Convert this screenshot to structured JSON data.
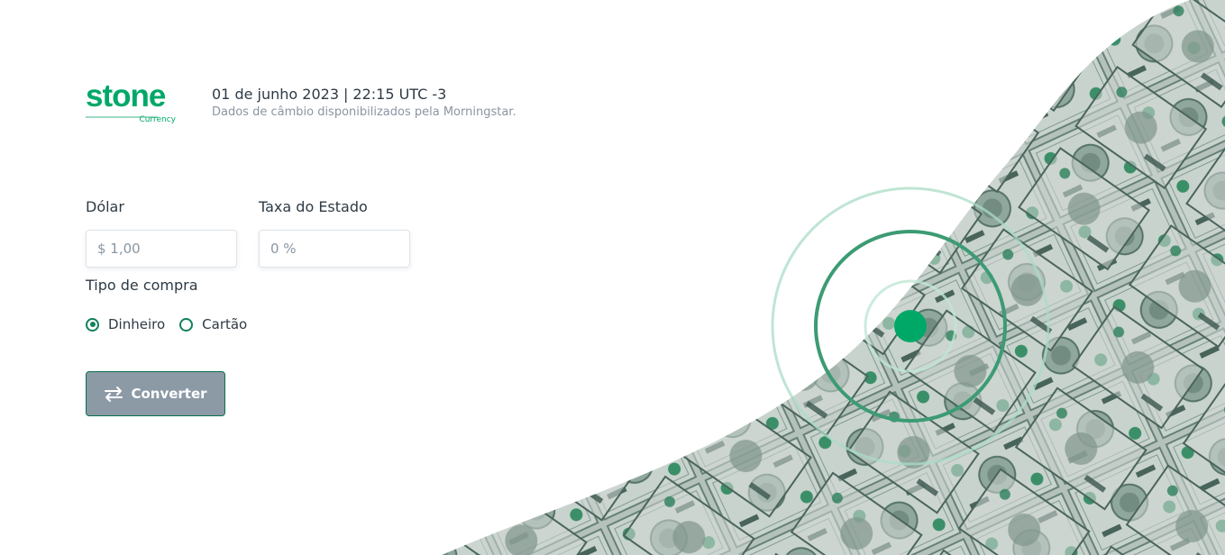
{
  "header": {
    "logo_text": "stone",
    "logo_sub": "Currency",
    "date": "01 de junho 2023",
    "separator": "|",
    "time": "22:15 UTC -3",
    "source": "Dados de câmbio disponibilizados pela Morningstar."
  },
  "form": {
    "dollar_label": "Dólar",
    "dollar_placeholder": "$ 1,00",
    "tax_label": "Taxa do Estado",
    "tax_placeholder": "0 %",
    "purchase_type_label": "Tipo de compra",
    "options": [
      {
        "label": "Dinheiro",
        "checked": true
      },
      {
        "label": "Cartão",
        "checked": false
      }
    ],
    "convert_label": "Converter"
  },
  "icons": {
    "convert": "swap-arrows-icon",
    "location": "location-pulse-icon"
  },
  "colors": {
    "brand_green": "#00a868",
    "dark_green": "#12805c",
    "button_bg": "#8c9aa6",
    "text": "#2e3a45",
    "muted_text": "#8a96a3"
  }
}
